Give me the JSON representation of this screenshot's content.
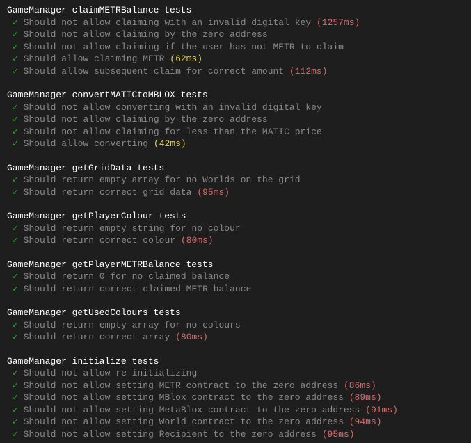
{
  "suites": [
    {
      "title": "GameManager claimMETRBalance tests",
      "tests": [
        {
          "desc": "Should not allow claiming with an invalid digital key",
          "timing": "(1257ms)",
          "timing_class": "timing-red"
        },
        {
          "desc": "Should not allow claiming by the zero address"
        },
        {
          "desc": "Should not allow claiming if the user has not METR to claim"
        },
        {
          "desc": "Should allow claiming METR",
          "timing": "(62ms)",
          "timing_class": "timing-yellow"
        },
        {
          "desc": "Should allow subsequent claim for correct amount",
          "timing": "(112ms)",
          "timing_class": "timing-red"
        }
      ]
    },
    {
      "title": "GameManager convertMATICtoMBLOX tests",
      "tests": [
        {
          "desc": "Should not allow converting with an invalid digital key"
        },
        {
          "desc": "Should not allow claiming by the zero address"
        },
        {
          "desc": "Should not allow claiming for less than the MATIC price"
        },
        {
          "desc": "Should allow converting",
          "timing": "(42ms)",
          "timing_class": "timing-yellow"
        }
      ]
    },
    {
      "title": "GameManager getGridData tests",
      "tests": [
        {
          "desc": "Should return empty array for no Worlds on the grid"
        },
        {
          "desc": "Should return correct grid data",
          "timing": "(95ms)",
          "timing_class": "timing-red"
        }
      ]
    },
    {
      "title": "GameManager getPlayerColour tests",
      "tests": [
        {
          "desc": "Should return empty string for no colour"
        },
        {
          "desc": "Should return correct colour",
          "timing": "(80ms)",
          "timing_class": "timing-red"
        }
      ]
    },
    {
      "title": "GameManager getPlayerMETRBalance tests",
      "tests": [
        {
          "desc": "Should return 0 for no claimed balance"
        },
        {
          "desc": "Should return correct claimed METR balance"
        }
      ]
    },
    {
      "title": "GameManager getUsedColours tests",
      "tests": [
        {
          "desc": "Should return empty array for no colours"
        },
        {
          "desc": "Should return correct array",
          "timing": "(80ms)",
          "timing_class": "timing-red"
        }
      ]
    },
    {
      "title": "GameManager initialize tests",
      "tests": [
        {
          "desc": "Should not allow re-initializing"
        },
        {
          "desc": "Should not allow setting METR contract to the zero address",
          "timing": "(86ms)",
          "timing_class": "timing-red"
        },
        {
          "desc": "Should not allow setting MBlox contract to the zero address",
          "timing": "(89ms)",
          "timing_class": "timing-red"
        },
        {
          "desc": "Should not allow setting MetaBlox contract to the zero address",
          "timing": "(91ms)",
          "timing_class": "timing-red"
        },
        {
          "desc": "Should not allow setting World contract to the zero address",
          "timing": "(94ms)",
          "timing_class": "timing-red"
        },
        {
          "desc": "Should not allow setting Recipient to the zero address",
          "timing": "(95ms)",
          "timing_class": "timing-red"
        }
      ]
    }
  ],
  "check_glyph": "✓"
}
